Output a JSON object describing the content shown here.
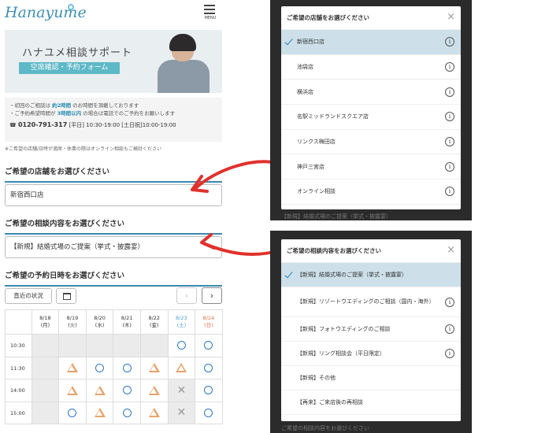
{
  "header": {
    "logo": "Hanayume",
    "menu_label": "MENU"
  },
  "hero": {
    "title": "ハナユメ相談サポート",
    "band": "空席確認・予約フォーム"
  },
  "info": {
    "line1_pre": "・初回のご相談は ",
    "line1_em": "約2時間",
    "line1_post": " のお時間を頂戴しております",
    "line2_pre": "・ご予約希望時間が ",
    "line2_em": "3時間以内",
    "line2_post": " の場合は電話でのご予約をお願いします",
    "tel": "0120-791-317",
    "hours": " [平日] 10:30-19:00 [土日祝]10:00-19:00"
  },
  "note": "※ご希望の店舗/日時が満席・休業の際はオンライン相談もご検討ください",
  "store_section": {
    "title": "ご希望の店舗をお選びください",
    "value": "新宿西口店"
  },
  "content_section": {
    "title": "ご希望の相談内容をお選びください",
    "value": "【新規】結婚式場のご提案（挙式・披露宴）"
  },
  "datetime_section": {
    "title": "ご希望の予約日時をお選びください",
    "status_button": "直近の状況",
    "prev": "‹",
    "next": "›"
  },
  "calendar": {
    "days": [
      {
        "date": "8/18",
        "dow": "(月)",
        "type": "weekday"
      },
      {
        "date": "8/19",
        "dow": "(火)",
        "type": "weekday"
      },
      {
        "date": "8/20",
        "dow": "(水)",
        "type": "weekday"
      },
      {
        "date": "8/21",
        "dow": "(木)",
        "type": "weekday"
      },
      {
        "date": "8/22",
        "dow": "(金)",
        "type": "weekday"
      },
      {
        "date": "8/23",
        "dow": "(土)",
        "type": "sat"
      },
      {
        "date": "8/24",
        "dow": "(日)",
        "type": "sun"
      }
    ],
    "rows": [
      {
        "time": "10:30",
        "slots": [
          "na",
          "na",
          "na",
          "na",
          "na",
          "circle",
          "circle"
        ]
      },
      {
        "time": "11:30",
        "slots": [
          "na",
          "tri",
          "circle",
          "circle",
          "tri",
          "tri",
          "circle"
        ]
      },
      {
        "time": "14:00",
        "slots": [
          "na",
          "tri",
          "tri",
          "circle",
          "tri",
          "cross",
          "circle"
        ]
      },
      {
        "time": "15:00",
        "slots": [
          "na",
          "circle",
          "tri",
          "circle",
          "tri",
          "cross",
          "circle"
        ]
      }
    ]
  },
  "store_modal": {
    "title": "ご希望の店舗をお選びください",
    "close": "×",
    "options": [
      {
        "label": "新宿西口店",
        "selected": true
      },
      {
        "label": "池袋店",
        "selected": false
      },
      {
        "label": "横浜店",
        "selected": false
      },
      {
        "label": "名駅ミッドランドスクエア店",
        "selected": false
      },
      {
        "label": "リンクス梅田店",
        "selected": false
      },
      {
        "label": "神戸三宮店",
        "selected": false
      },
      {
        "label": "オンライン相談",
        "selected": false
      }
    ],
    "behind_text": "【新規】結婚式場のご提案（挙式・披露宴）"
  },
  "content_modal": {
    "title": "ご希望の相談内容をお選びください",
    "close": "×",
    "options": [
      {
        "label": "【新規】結婚式場のご提案（挙式・披露宴）",
        "selected": true,
        "info": false
      },
      {
        "label": "【新規】リゾートウエディングのご相談（国内・海外）",
        "selected": false,
        "info": true
      },
      {
        "label": "【新規】フォトウエディングのご相談",
        "selected": false,
        "info": true
      },
      {
        "label": "【新規】リング相談会（平日限定）",
        "selected": false,
        "info": true
      },
      {
        "label": "【新規】その他",
        "selected": false,
        "info": false
      },
      {
        "label": "【再来】ご来店後の再相談",
        "selected": false,
        "info": false
      }
    ],
    "behind_text": "ご希望の相談内容をお選びください"
  },
  "icons": {
    "info": "i",
    "arrow_color": "#e0312c"
  }
}
